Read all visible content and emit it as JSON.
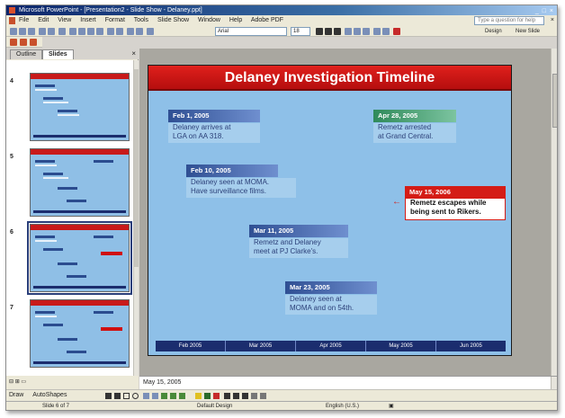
{
  "window": {
    "title": "Microsoft PowerPoint - [Presentation2 - Slide Show - Delaney.ppt]",
    "controls": "_ □ ×"
  },
  "menu": {
    "items": [
      "File",
      "Edit",
      "View",
      "Insert",
      "Format",
      "Tools",
      "Slide Show",
      "Window",
      "Help",
      "Adobe PDF"
    ],
    "help_placeholder": "Type a question for help"
  },
  "toolbar": {
    "font_name": "Arial",
    "font_size": "18",
    "design_label": "Design",
    "new_slide_label": "New Slide"
  },
  "pane": {
    "tabs": [
      "Outline",
      "Slides"
    ],
    "active_tab": "Slides",
    "thumb_numbers": [
      "4",
      "5",
      "6",
      "7"
    ]
  },
  "slide": {
    "title": "Delaney Investigation Timeline",
    "events": [
      {
        "date": "Feb 1, 2005",
        "text_lines": [
          "Delaney arrives at",
          "LGA on AA 318."
        ]
      },
      {
        "date": "Apr 28, 2005",
        "text_lines": [
          "Remetz arrested",
          "at Grand Central."
        ]
      },
      {
        "date": "Feb 10, 2005",
        "text_lines": [
          "Delaney seen at MOMA.",
          "Have surveillance  films."
        ]
      },
      {
        "date": "May 15, 2006",
        "text_lines": [
          "Remetz escapes while",
          "being sent to Rikers."
        ]
      },
      {
        "date": "Mar 11, 2005",
        "text_lines": [
          "Remetz and Delaney",
          "meet at PJ Clarke's."
        ]
      },
      {
        "date": "Mar 23, 2005",
        "text_lines": [
          "Delaney seen at",
          "MOMA and on 54th."
        ]
      }
    ],
    "timeline": [
      "Feb 2005",
      "Mar 2005",
      "Apr 2005",
      "May 2005",
      "Jun 2005"
    ]
  },
  "notes": {
    "text": "May 15, 2005"
  },
  "drawbar": {
    "draw_label": "Draw",
    "autoshapes_label": "AutoShapes"
  },
  "status": {
    "slide_position": "Slide 6 of 7",
    "design": "Default Design",
    "language": "English (U.S.)"
  },
  "colors": {
    "slide_bg": "#8ec0e8",
    "title_red": "#d41c16",
    "header_blue": "#2f4f93",
    "timeline_navy": "#1b2d6e"
  }
}
